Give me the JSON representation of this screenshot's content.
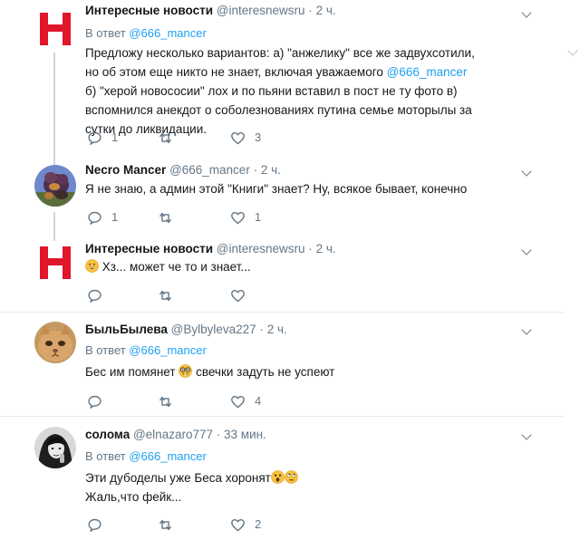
{
  "tweets": [
    {
      "name": "Интересные новости",
      "handle": "@interesnewsru",
      "dot": "·",
      "time": "2 ч.",
      "reply_prefix": "В ответ",
      "reply_to": "@666_mancer",
      "text_a": "Предложу несколько вариантов: а) \"анжелику\" все же задвухсотили, но об этом еще никто не знает, включая уважаемого",
      "mention": "@666_mancer",
      "text_b": "б) \"херой новососии\" лох и по пьяни вставил в пост не ту фото в) вспомнился анекдот о соболезнованиях путина семье моторылы за сутки до ликвидации.",
      "reply_count": "1",
      "retweet_count": "",
      "like_count": "3",
      "avatar": "h-logo-icon"
    },
    {
      "name": "Necro Mancer",
      "handle": "@666_mancer",
      "dot": "·",
      "time": "2 ч.",
      "text": "Я не знаю, а админ этой \"Книги\" знает? Ну, всякое бывает, конечно",
      "reply_count": "1",
      "retweet_count": "",
      "like_count": "1",
      "avatar": "creature-avatar"
    },
    {
      "name": "Интересные новости",
      "handle": "@interesnewsru",
      "dot": "·",
      "time": "2 ч.",
      "text": "Хз... может че то и знает...",
      "emoji": "grinning-face",
      "reply_count": "",
      "retweet_count": "",
      "like_count": "",
      "avatar": "h-logo-icon"
    },
    {
      "name": "БыльБылева",
      "handle": "@Bylbyleva227",
      "dot": "·",
      "time": "2 ч.",
      "reply_prefix": "В ответ",
      "reply_to": "@666_mancer",
      "text_a": "Бес им помянет",
      "text_b": "свечки задуть не успеют",
      "emoji": "nerd-face",
      "reply_count": "",
      "retweet_count": "",
      "like_count": "4",
      "avatar": "cat-avatar"
    },
    {
      "name": "солома",
      "handle": "@elnazaro777",
      "dot": "·",
      "time": "33 мин.",
      "reply_prefix": "В ответ",
      "reply_to": "@666_mancer",
      "line1": "Эти дубоделы уже Беса хоронят",
      "line2": "Жаль,что фейк...",
      "emojis": [
        "astonished-face",
        "rolling-eyes-face"
      ],
      "reply_count": "",
      "retweet_count": "",
      "like_count": "2",
      "avatar": "bw-person-avatar"
    }
  ],
  "colors": {
    "link": "#1da1f2",
    "secondary": "#657786",
    "brand_red": "#e0162b",
    "divider": "#e6ecf0"
  }
}
